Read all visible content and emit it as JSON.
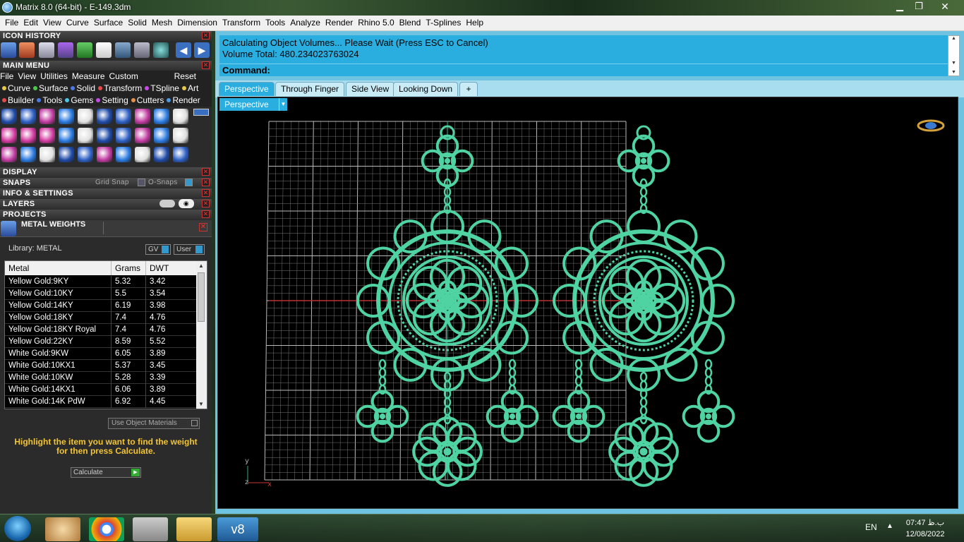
{
  "window": {
    "title": "Matrix 8.0 (64-bit) - E-149.3dm",
    "minimize": "▁",
    "restore": "❐",
    "close": "✕"
  },
  "menu": [
    "File",
    "Edit",
    "View",
    "Curve",
    "Surface",
    "Solid",
    "Mesh",
    "Dimension",
    "Transform",
    "Tools",
    "Analyze",
    "Render",
    "Rhino 5.0",
    "Blend",
    "T-Splines",
    "Help"
  ],
  "left": {
    "icon_history": "ICON HISTORY",
    "main_menu": "MAIN MENU",
    "main_menu_items": [
      "File",
      "View",
      "Utilities",
      "Measure",
      "Custom"
    ],
    "reset": "Reset",
    "categories1": [
      {
        "label": "Curve",
        "color": "#e6c84a"
      },
      {
        "label": "Surface",
        "color": "#4ac84a"
      },
      {
        "label": "Solid",
        "color": "#4a7ae6"
      },
      {
        "label": "Transform",
        "color": "#e64a4a"
      },
      {
        "label": "TSpline",
        "color": "#c84ae6"
      },
      {
        "label": "Art",
        "color": "#e6c84a"
      }
    ],
    "categories2": [
      {
        "label": "Builder",
        "color": "#e64a4a"
      },
      {
        "label": "Tools",
        "color": "#4a7ae6"
      },
      {
        "label": "Gems",
        "color": "#4ac8e6"
      },
      {
        "label": "Setting",
        "color": "#c84ae6"
      },
      {
        "label": "Cutters",
        "color": "#e6904a"
      },
      {
        "label": "Render",
        "color": "#4a9ae6"
      }
    ],
    "display": "DISPLAY",
    "snaps": "SNAPS",
    "grid_snap": "Grid Snap",
    "osnaps": "O-Snaps",
    "info": "INFO & SETTINGS",
    "layers": "LAYERS",
    "projects": "PROJECTS",
    "metal_weights": "METAL WEIGHTS",
    "library": "Library: METAL",
    "gv": "GV",
    "user": "User",
    "columns": [
      "Metal",
      "Grams",
      "DWT"
    ],
    "rows": [
      [
        "Yellow Gold:9KY",
        "5.32",
        "3.42"
      ],
      [
        "Yellow Gold:10KY",
        "5.5",
        "3.54"
      ],
      [
        "Yellow Gold:14KY",
        "6.19",
        "3.98"
      ],
      [
        "Yellow Gold:18KY",
        "7.4",
        "4.76"
      ],
      [
        "Yellow Gold:18KY Royal",
        "7.4",
        "4.76"
      ],
      [
        "Yellow Gold:22KY",
        "8.59",
        "5.52"
      ],
      [
        "White Gold:9KW",
        "6.05",
        "3.89"
      ],
      [
        "White Gold:10KX1",
        "5.37",
        "3.45"
      ],
      [
        "White Gold:10KW",
        "5.28",
        "3.39"
      ],
      [
        "White Gold:14KX1",
        "6.06",
        "3.89"
      ],
      [
        "White Gold:14K PdW",
        "6.92",
        "4.45"
      ]
    ],
    "use_object_materials": "Use Object Materials",
    "hint": "Highlight the item you want to find the weight for then press Calculate.",
    "calculate": "Calculate"
  },
  "command": {
    "line1": "Calculating Object Volumes... Please Wait (Press ESC to Cancel)",
    "line2": "Volume Total: 480.234023763024",
    "prompt": "Command:"
  },
  "tabs": [
    "Perspective",
    "Through Finger",
    "Side View",
    "Looking Down"
  ],
  "add_tab": "+",
  "viewport": {
    "label": "Perspective",
    "axis_y": "y",
    "axis_z": "z",
    "axis_x": "x"
  },
  "taskbar": {
    "lang": "EN",
    "time": "07:47 ب.ظ",
    "date": "12/08/2022"
  },
  "colors": {
    "jewelry": "#4fd3a3",
    "accent": "#2aaee0"
  }
}
